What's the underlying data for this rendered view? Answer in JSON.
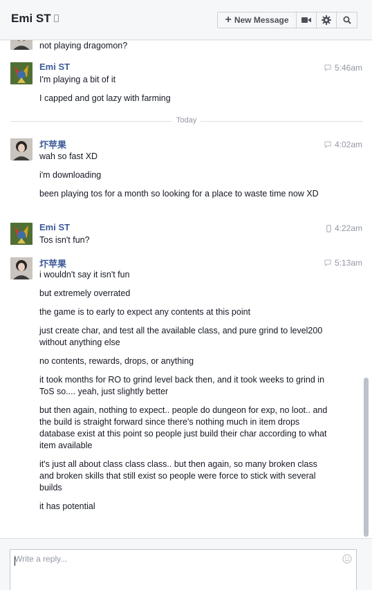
{
  "header": {
    "name": "Emi ST",
    "new_message_label": "New Message"
  },
  "divider": {
    "label": "Today"
  },
  "messages": [
    {
      "text": "not playing dragomon?"
    },
    {
      "sender": "Emi ST",
      "time": "5:46am",
      "lines": [
        "I'm playing a bit of it",
        "I capped and got lazy with farming"
      ]
    },
    {
      "sender": "圷苹果",
      "time": "4:02am",
      "lines": [
        "wah so fast XD",
        "i'm downloading",
        "been playing tos for a month so looking for a place to waste time now XD"
      ]
    },
    {
      "sender": "Emi ST",
      "time": "4:22am",
      "lines": [
        "Tos isn't fun?"
      ]
    },
    {
      "sender": "圷苹果",
      "time": "5:13am",
      "lines": [
        "i wouldn't say it isn't fun",
        "but extremely overrated",
        "the game is to early to expect any contents at this point",
        "just create char, and test all the available class, and pure grind to level200 without anything else",
        "no contents, rewards, drops, or anything",
        "it took months for RO to grind level back then, and it took weeks to grind in ToS so.... yeah, just slightly better",
        "but then again, nothing to expect.. people do dungeon for exp, no loot.. and the build is straight forward since there's nothing much in item drops database exist at this point so people just build their char according to what item available",
        "it's just all about class class class.. but then again, so many broken class and broken skills that still exist so people were force to stick with several builds",
        "it has potential"
      ]
    }
  ],
  "composer": {
    "placeholder": "Write a reply..."
  }
}
